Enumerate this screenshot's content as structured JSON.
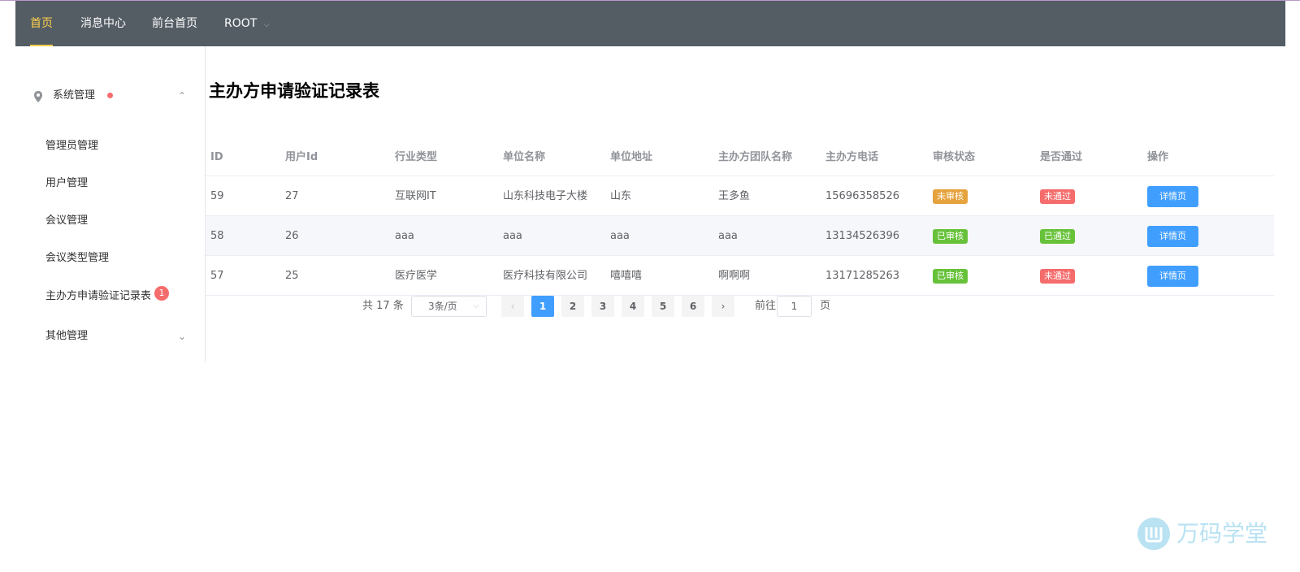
{
  "nav": {
    "items": [
      {
        "label": "首页",
        "active": true
      },
      {
        "label": "消息中心"
      },
      {
        "label": "前台首页"
      },
      {
        "label": "ROOT",
        "has_dropdown": true
      }
    ]
  },
  "sidebar": {
    "submenu": {
      "label": "系统管理",
      "icon": "location-pin-icon",
      "has_dot": true,
      "expanded": true
    },
    "items": [
      {
        "label": "管理员管理"
      },
      {
        "label": "用户管理"
      },
      {
        "label": "会议管理"
      },
      {
        "label": "会议类型管理"
      },
      {
        "label": "主办方申请验证记录表",
        "badge": "1"
      },
      {
        "label": "其他管理",
        "has_arrow": true
      }
    ]
  },
  "page": {
    "title": "主办方申请验证记录表"
  },
  "table": {
    "columns": [
      "ID",
      "用户Id",
      "行业类型",
      "单位名称",
      "单位地址",
      "主办方团队名称",
      "主办方电话",
      "审核状态",
      "是否通过",
      "操作"
    ],
    "rows": [
      {
        "id": "59",
        "user_id": "27",
        "industry": "互联网IT",
        "unit_name": "山东科技电子大楼",
        "address": "山东",
        "team": "王多鱼",
        "phone": "15696358526",
        "review": "未审核",
        "review_color": "#e6a23c",
        "passed": "未通过",
        "passed_color": "#f56c6c",
        "action": "详情页"
      },
      {
        "id": "58",
        "user_id": "26",
        "industry": "aaa",
        "unit_name": "aaa",
        "address": "aaa",
        "team": "aaa",
        "phone": "13134526396",
        "review": "已审核",
        "review_color": "#67c23a",
        "passed": "已通过",
        "passed_color": "#67c23a",
        "action": "详情页"
      },
      {
        "id": "57",
        "user_id": "25",
        "industry": "医疗医学",
        "unit_name": "医疗科技有限公司",
        "address": "嘻嘻嘻",
        "team": "啊啊啊",
        "phone": "13171285263",
        "review": "已审核",
        "review_color": "#67c23a",
        "passed": "未通过",
        "passed_color": "#f56c6c",
        "action": "详情页"
      }
    ]
  },
  "pagination": {
    "total_text": "共 17 条",
    "page_size": "3条/页",
    "pages": [
      "1",
      "2",
      "3",
      "4",
      "5",
      "6"
    ],
    "current_page": "1",
    "goto_label": "前往",
    "goto_value": "1",
    "page_unit": "页"
  },
  "watermark": {
    "text": "万码学堂"
  },
  "colors": {
    "navbar": "#545c64",
    "nav_active": "#ffd04b",
    "primary": "#409eff",
    "warning": "#e6a23c",
    "success": "#67c23a",
    "danger": "#f56c6c"
  }
}
